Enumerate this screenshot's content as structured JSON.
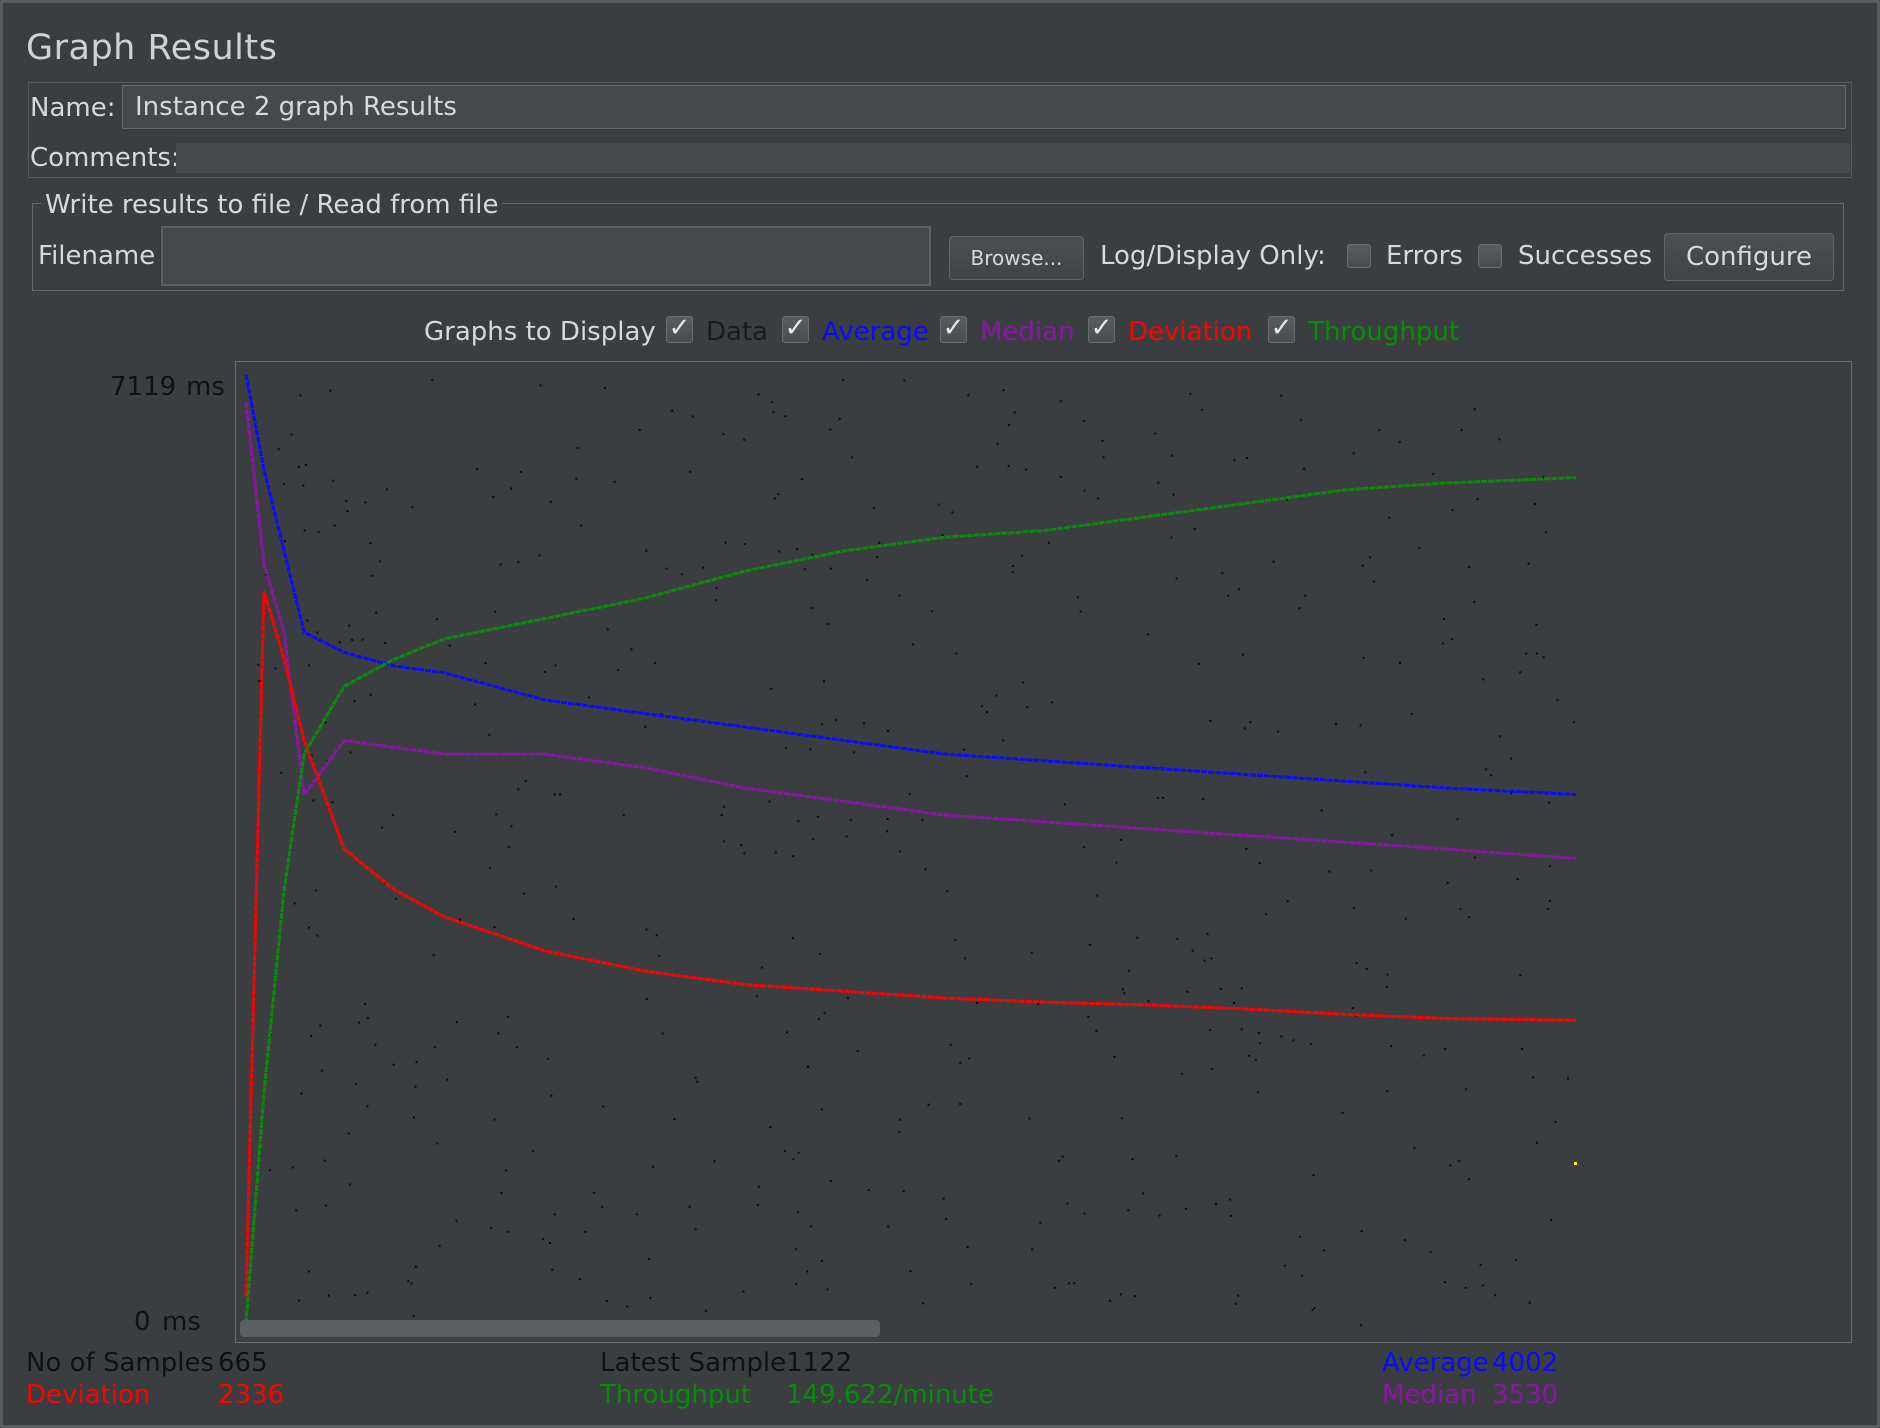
{
  "panel": {
    "title": "Graph Results",
    "name_label": "Name:",
    "name_value": "Instance 2 graph Results",
    "comments_label": "Comments:",
    "comments_value": ""
  },
  "file_group": {
    "legend": "Write results to file / Read from file",
    "filename_label": "Filename",
    "filename_value": "",
    "browse_label": "Browse...",
    "log_display_label": "Log/Display Only:",
    "errors_label": "Errors",
    "errors_checked": false,
    "successes_label": "Successes",
    "successes_checked": false,
    "configure_label": "Configure"
  },
  "graphs_to_display": {
    "label": "Graphs to Display",
    "options": [
      {
        "label": "Data",
        "checked": true,
        "color": "#111111"
      },
      {
        "label": "Average",
        "checked": true,
        "color": "#0a0aff"
      },
      {
        "label": "Median",
        "checked": true,
        "color": "#8a16a8"
      },
      {
        "label": "Deviation",
        "checked": true,
        "color": "#ff0000"
      },
      {
        "label": "Throughput",
        "checked": true,
        "color": "#0a8a0a"
      }
    ]
  },
  "axis": {
    "max_label": "7119",
    "min_label": "0",
    "unit": "ms"
  },
  "stats": {
    "samples_label": "No of Samples",
    "samples_value": "665",
    "latest_label": "Latest Sample",
    "latest_value": "1122",
    "average_label": "Average",
    "average_value": "4002",
    "deviation_label": "Deviation",
    "deviation_value": "2336",
    "throughput_label": "Throughput",
    "throughput_value": "149.622/minute",
    "median_label": "Median",
    "median_value": "3530"
  },
  "chart_data": {
    "type": "line",
    "ylim": [
      0,
      7119
    ],
    "x": [
      1,
      10,
      20,
      30,
      50,
      75,
      100,
      150,
      200,
      250,
      300,
      350,
      400,
      450,
      500,
      550,
      600,
      665
    ],
    "series": [
      {
        "name": "Average",
        "color": "#0a0aff",
        "values": [
          7100,
          6400,
          5800,
          5200,
          5050,
          4950,
          4900,
          4700,
          4600,
          4500,
          4400,
          4300,
          4250,
          4200,
          4150,
          4100,
          4050,
          4002
        ]
      },
      {
        "name": "Median",
        "color": "#8a16a8",
        "values": [
          6900,
          5700,
          5200,
          4000,
          4400,
          4350,
          4300,
          4300,
          4200,
          4050,
          3950,
          3850,
          3800,
          3750,
          3700,
          3650,
          3600,
          3530
        ]
      },
      {
        "name": "Deviation",
        "color": "#ff0000",
        "values": [
          300,
          5500,
          5000,
          4400,
          3600,
          3300,
          3100,
          2850,
          2700,
          2600,
          2550,
          2500,
          2470,
          2450,
          2420,
          2380,
          2350,
          2336
        ]
      },
      {
        "name": "Throughput",
        "color": "#0a8a0a",
        "values": [
          100,
          1800,
          3300,
          4300,
          4800,
          5000,
          5150,
          5300,
          5450,
          5650,
          5800,
          5900,
          5950,
          6050,
          6150,
          6250,
          6300,
          6340
        ]
      }
    ]
  }
}
